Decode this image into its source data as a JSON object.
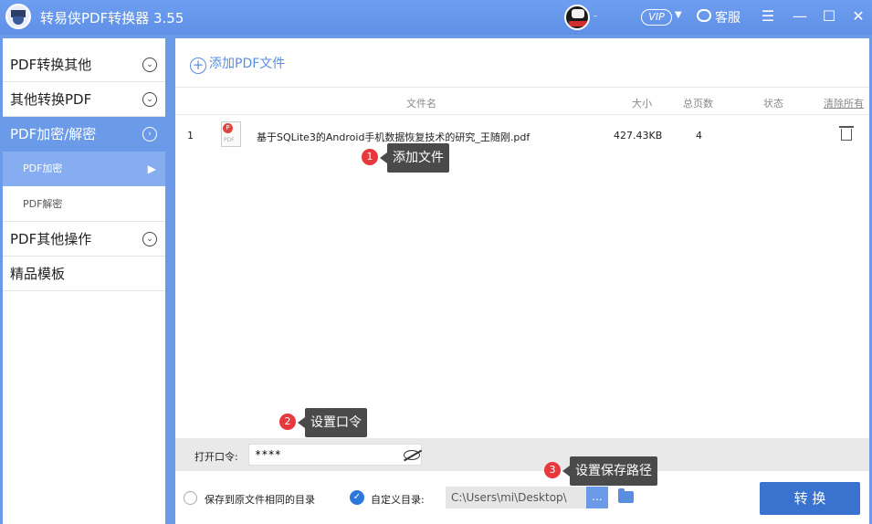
{
  "title_bar": {
    "title": "转易侠PDF转换器 3.55",
    "user_suffix": "-",
    "vip_label": "VIP",
    "service_label": "客服"
  },
  "sidebar": {
    "items": [
      {
        "label": "PDF转换其他"
      },
      {
        "label": "其他转换PDF"
      },
      {
        "label": "PDF加密/解密"
      },
      {
        "label": "PDF其他操作"
      },
      {
        "label": "精品模板"
      }
    ],
    "sub_items": [
      {
        "label": "PDF加密"
      },
      {
        "label": "PDF解密"
      }
    ]
  },
  "toolbar": {
    "add_label": "添加PDF文件"
  },
  "table": {
    "headers": {
      "name": "文件名",
      "size": "大小",
      "pages": "总页数",
      "status": "状态",
      "clear_all": "清除所有"
    },
    "rows": [
      {
        "index": "1",
        "name": "基于SQLite3的Android手机数据恢复技术的研究_王随刚.pdf",
        "size": "427.43KB",
        "pages": "4",
        "status": ""
      }
    ]
  },
  "tooltips": [
    {
      "step": "1",
      "text": "添加文件"
    },
    {
      "step": "2",
      "text": "设置口令"
    },
    {
      "step": "3",
      "text": "设置保存路径"
    }
  ],
  "password": {
    "label": "打开口令:",
    "value": "****"
  },
  "save": {
    "same_dir_label": "保存到原文件相同的目录",
    "custom_dir_label": "自定义目录:",
    "path": "C:\\Users\\mi\\Desktop\\",
    "browse_label": "...",
    "convert_label": "转 换"
  },
  "icons": [
    "app-logo",
    "user-avatar",
    "chat-icon",
    "menu-icon",
    "minimize-icon",
    "maximize-icon",
    "close-icon",
    "chevron-down-icon",
    "chevron-right-icon",
    "plus-circle-icon",
    "pdf-file-icon",
    "trash-icon",
    "eye-off-icon",
    "check-icon",
    "folder-icon"
  ],
  "colors": {
    "accent": "#6b9ae8",
    "accent_dark": "#3a73cf",
    "step_badge": "#e8383d",
    "tooltip_bg": "#4a4a4a"
  }
}
